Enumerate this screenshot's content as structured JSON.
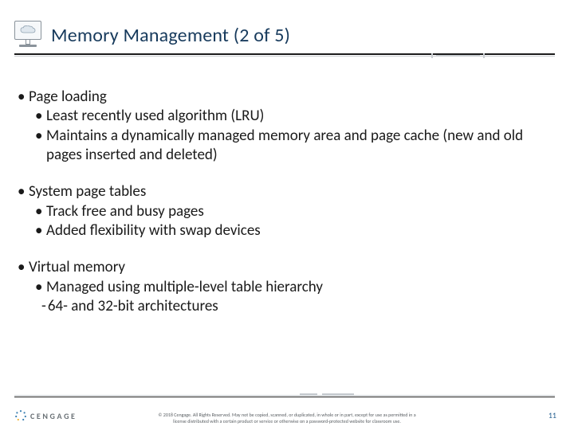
{
  "header": {
    "title": "Memory Management (2 of 5)",
    "icon": "cloud-monitor-icon"
  },
  "body": {
    "groups": [
      {
        "l1": "Page loading",
        "l2": [
          "Least recently used algorithm (LRU)",
          "Maintains a dynamically managed memory area and page cache (new and old pages inserted and deleted)"
        ]
      },
      {
        "l1": "System page tables",
        "l2": [
          "Track free and busy pages",
          "Added flexibility with swap devices"
        ]
      },
      {
        "l1": "Virtual memory",
        "l2": [
          "Managed using multiple-level table hierarchy"
        ],
        "l3dash": [
          "64- and 32-bit architectures"
        ]
      }
    ]
  },
  "footer": {
    "logo_text": "CENGAGE",
    "copyright_l1": "© 2018 Cengage. All Rights Reserved. May not be copied, scanned, or duplicated, in whole or in part, except for use as permitted in a",
    "copyright_l2": "license distributed with a certain product or service or otherwise on a password-protected website for classroom use.",
    "page_number": "11"
  }
}
